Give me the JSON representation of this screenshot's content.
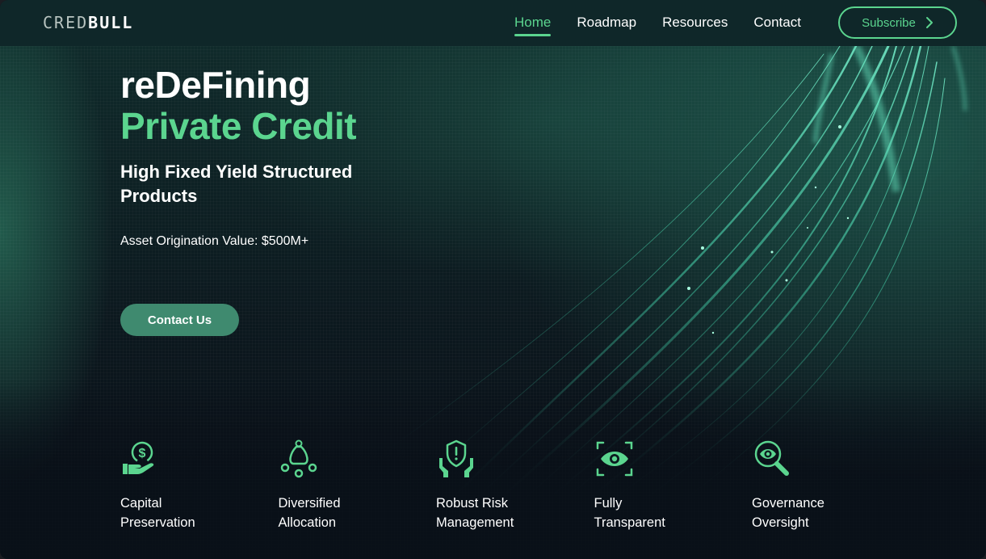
{
  "header": {
    "logo": {
      "part1": "CRED",
      "part2": "BULL"
    },
    "nav": [
      {
        "label": "Home",
        "active": true
      },
      {
        "label": "Roadmap",
        "active": false
      },
      {
        "label": "Resources",
        "active": false
      },
      {
        "label": "Contact",
        "active": false
      }
    ],
    "subscribe_label": "Subscribe"
  },
  "hero": {
    "title_line1": "reDeFining",
    "title_line2": "Private Credit",
    "subtitle": "High Fixed Yield Structured Products",
    "origination": "Asset Origination Value: $500M+",
    "cta_label": "Contact Us"
  },
  "features": [
    {
      "icon": "hand-dollar-icon",
      "line1": "Capital",
      "line2": "Preservation"
    },
    {
      "icon": "money-bag-allocation-icon",
      "line1": "Diversified",
      "line2": "Allocation"
    },
    {
      "icon": "shield-hands-icon",
      "line1": "Robust Risk",
      "line2": "Management"
    },
    {
      "icon": "eye-scan-icon",
      "line1": "Fully",
      "line2": "Transparent"
    },
    {
      "icon": "magnifier-eye-icon",
      "line1": "Governance",
      "line2": "Oversight"
    }
  ],
  "colors": {
    "accent": "#5bd58f",
    "button": "#3f8a6f",
    "header_bg": "#0f2729",
    "page_bg": "#0a1017"
  }
}
